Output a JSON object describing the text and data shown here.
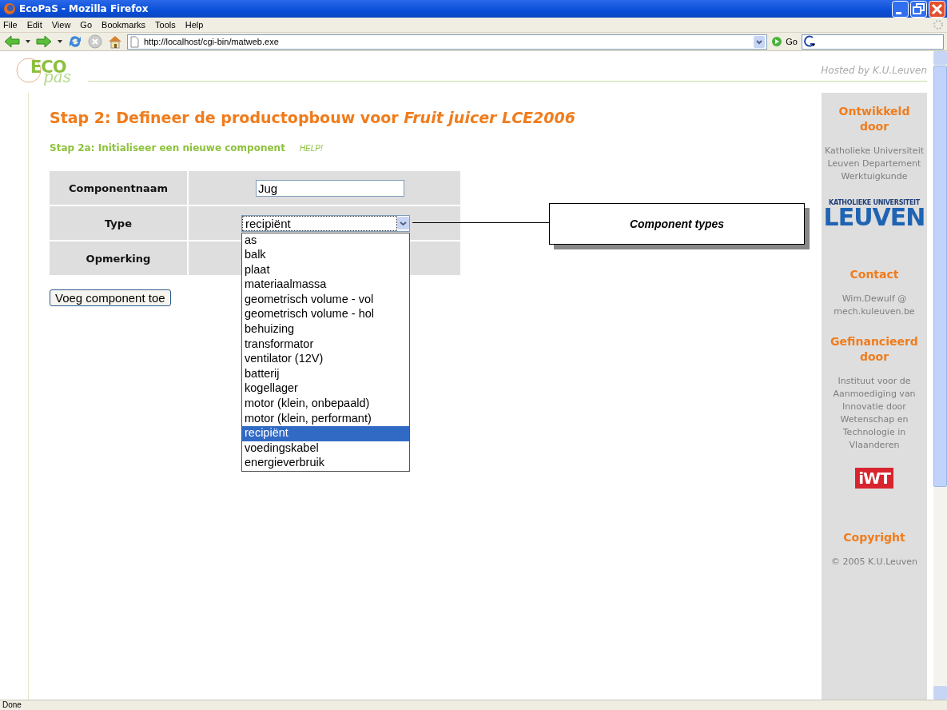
{
  "window": {
    "title": "EcoPaS - Mozilla Firefox"
  },
  "menu": [
    {
      "label": "File"
    },
    {
      "label": "Edit"
    },
    {
      "label": "View"
    },
    {
      "label": "Go"
    },
    {
      "label": "Bookmarks"
    },
    {
      "label": "Tools"
    },
    {
      "label": "Help"
    }
  ],
  "toolbar": {
    "url": "http://localhost/cgi-bin/matweb.exe",
    "go": "Go"
  },
  "header": {
    "logo_main": "ECO",
    "logo_sub": "pas",
    "hosted": "Hosted by K.U.Leuven"
  },
  "page": {
    "heading": "Stap 2: Defineer de productopbouw voor *Fruit juicer LCE2006*",
    "subheading": "Stap 2a: Initialiseer een nieuwe component",
    "help": "HELP!",
    "form": [
      {
        "label": "Componentnaam",
        "kind": "text",
        "value": "Jug"
      },
      {
        "label": "Type",
        "kind": "select",
        "value": "recipiënt",
        "expanded": true
      },
      {
        "label": "Opmerking",
        "kind": "empty"
      }
    ],
    "options": [
      {
        "label": "as",
        "selected": false
      },
      {
        "label": "balk",
        "selected": false
      },
      {
        "label": "plaat",
        "selected": false
      },
      {
        "label": "materiaalmassa",
        "selected": false
      },
      {
        "label": "geometrisch volume - vol",
        "selected": false
      },
      {
        "label": "geometrisch volume - hol",
        "selected": false
      },
      {
        "label": "behuizing",
        "selected": false
      },
      {
        "label": "transformator",
        "selected": false
      },
      {
        "label": "ventilator (12V)",
        "selected": false
      },
      {
        "label": "batterij",
        "selected": false
      },
      {
        "label": "kogellager",
        "selected": false
      },
      {
        "label": "motor (klein, onbepaald)",
        "selected": false
      },
      {
        "label": "motor (klein, performant)",
        "selected": false
      },
      {
        "label": "recipiënt",
        "selected": true
      },
      {
        "label": "voedingskabel",
        "selected": false
      },
      {
        "label": "energieverbruik",
        "selected": false
      }
    ],
    "button": "Voeg component toe",
    "callout": "Component types"
  },
  "sidebar": [
    {
      "title": "Ontwikkeld door",
      "text": "Katholieke Universiteit Leuven Departement Werktuigkunde",
      "logo": {
        "kind": "kul",
        "top": "KATHOLIEKE UNIVERSITEIT",
        "main": "LEUVEN"
      }
    },
    {
      "title": "Contact",
      "text": "Wim.Dewulf @ mech.kuleuven.be"
    },
    {
      "title": "Gefinancieerd door",
      "text": "Instituut voor de Aanmoediging van Innovatie door Wetenschap en Technologie in Vlaanderen",
      "logo": {
        "kind": "iwt",
        "main": "iWT"
      }
    },
    {
      "title": "Copyright",
      "text": "© 2005 K.U.Leuven"
    }
  ],
  "status_bar": "Done"
}
